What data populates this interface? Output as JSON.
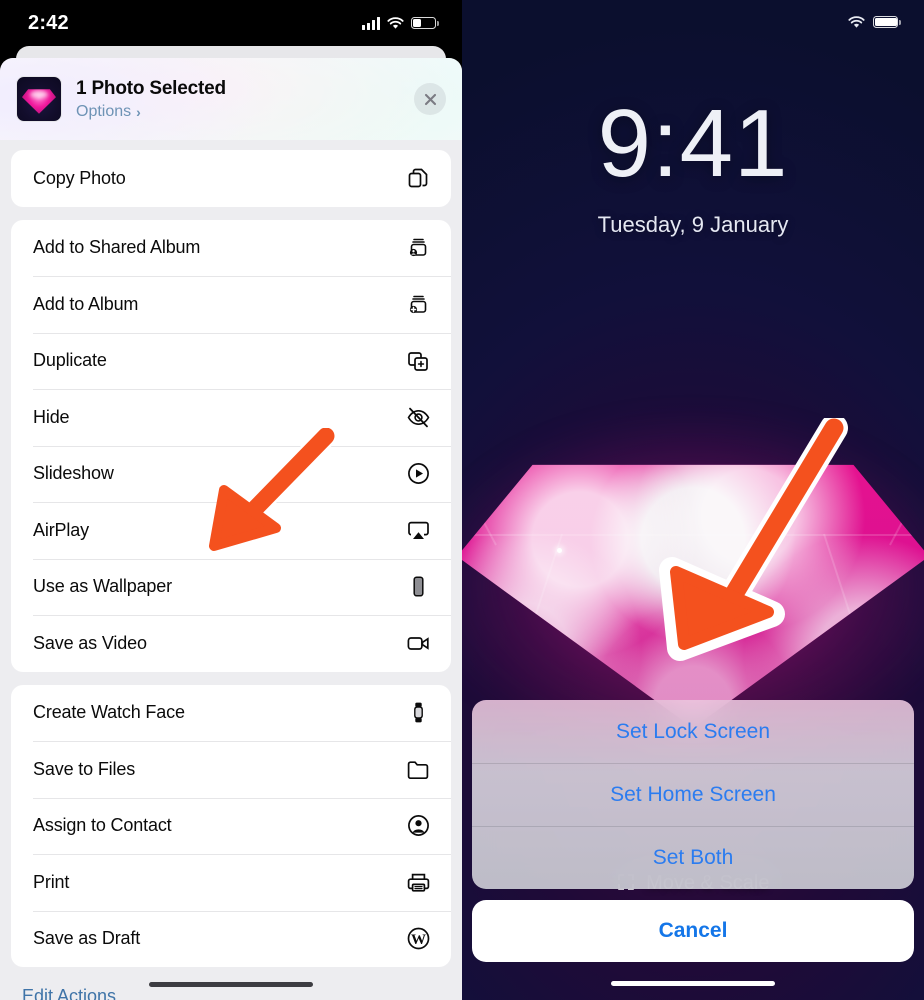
{
  "left_panel": {
    "status_bar": {
      "time": "2:42",
      "icons": [
        "cellular-signal-icon",
        "wifi-icon",
        "battery-icon"
      ],
      "battery_level_pct": 32
    },
    "share_sheet": {
      "header": {
        "title": "1 Photo Selected",
        "options_label": "Options",
        "options_chevron": "›",
        "thumbnail_name": "photo-thumbnail",
        "close_icon": "close-icon"
      },
      "groups": [
        {
          "rows": [
            {
              "label": "Copy Photo",
              "icon": "copy-icon"
            }
          ]
        },
        {
          "rows": [
            {
              "label": "Add to Shared Album",
              "icon": "shared-album-icon"
            },
            {
              "label": "Add to Album",
              "icon": "add-to-album-icon"
            },
            {
              "label": "Duplicate",
              "icon": "duplicate-icon"
            },
            {
              "label": "Hide",
              "icon": "eye-slash-icon"
            },
            {
              "label": "Slideshow",
              "icon": "play-circle-icon"
            },
            {
              "label": "AirPlay",
              "icon": "airplay-icon"
            },
            {
              "label": "Use as Wallpaper",
              "icon": "iphone-icon"
            },
            {
              "label": "Save as Video",
              "icon": "video-camera-icon"
            }
          ]
        },
        {
          "rows": [
            {
              "label": "Create Watch Face",
              "icon": "apple-watch-icon"
            },
            {
              "label": "Save to Files",
              "icon": "folder-icon"
            },
            {
              "label": "Assign to Contact",
              "icon": "person-circle-icon"
            },
            {
              "label": "Print",
              "icon": "printer-icon"
            },
            {
              "label": "Save as Draft",
              "icon": "wordpress-icon"
            }
          ]
        }
      ],
      "edit_actions_label": "Edit Actions"
    }
  },
  "right_panel": {
    "status_bar": {
      "icons": [
        "wifi-icon",
        "battery-icon"
      ],
      "battery_level_pct": 100
    },
    "lock_screen": {
      "time": "9:41",
      "date": "Tuesday, 9 January",
      "wallpaper_name": "pink-gem-wallpaper"
    },
    "move_scale_label": "Move & Scale",
    "action_sheet": {
      "options": [
        {
          "label": "Set Lock Screen"
        },
        {
          "label": "Set Home Screen"
        },
        {
          "label": "Set Both"
        }
      ],
      "cancel_label": "Cancel"
    }
  },
  "annotations": {
    "arrow_color": "#F4511E",
    "arrow_outline_color": "#FFFFFF",
    "arrows": [
      {
        "name": "arrow-pointing-to-use-as-wallpaper"
      },
      {
        "name": "arrow-pointing-to-set-lock-screen"
      }
    ]
  },
  "colors": {
    "accent_blue": "#2B7CF0",
    "cancel_blue": "#1476E8",
    "options_blue": "#6E93B5",
    "edit_actions_blue": "#3F74A8",
    "gem_pink": "#E8128F",
    "sheet_bg": "#EDEDF0",
    "row_bg": "#FFFFFF",
    "lock_bg": "#0A0D28"
  }
}
